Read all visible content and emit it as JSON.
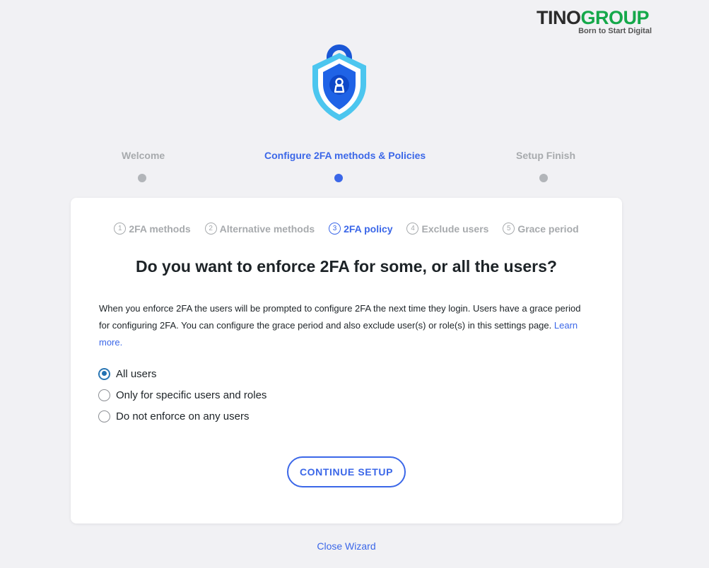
{
  "brand": {
    "name_part1": "TINO",
    "name_part2": "GROUP",
    "tagline": "Born to Start Digital"
  },
  "wizard_steps": [
    {
      "label": "Welcome",
      "active": false
    },
    {
      "label": "Configure 2FA methods & Policies",
      "active": true
    },
    {
      "label": "Setup Finish",
      "active": false
    }
  ],
  "sub_steps": [
    {
      "num": "1",
      "label": "2FA methods"
    },
    {
      "num": "2",
      "label": "Alternative methods"
    },
    {
      "num": "3",
      "label": "2FA policy"
    },
    {
      "num": "4",
      "label": "Exclude users"
    },
    {
      "num": "5",
      "label": "Grace period"
    }
  ],
  "main": {
    "headline": "Do you want to enforce 2FA for some, or all the users?",
    "description": "When you enforce 2FA the users will be prompted to configure 2FA the next time they login. Users have a grace period for configuring 2FA. You can configure the grace period and also exclude user(s) or role(s) in this settings page.",
    "learn_more": "Learn more.",
    "options": [
      {
        "label": "All users",
        "checked": true
      },
      {
        "label": "Only for specific users and roles",
        "checked": false
      },
      {
        "label": "Do not enforce on any users",
        "checked": false
      }
    ],
    "continue_label": "CONTINUE SETUP"
  },
  "footer": {
    "close_wizard": "Close Wizard"
  },
  "colors": {
    "accent": "#3b67e8",
    "brand_green": "#15a84a",
    "radio_checked": "#2271b1",
    "inactive": "#a7aaad"
  },
  "icons": {
    "hero": "shield-lock-icon",
    "brand": "house-icon"
  }
}
